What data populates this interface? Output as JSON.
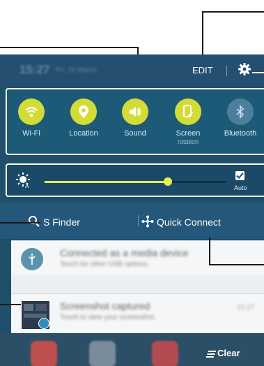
{
  "status_bar": {
    "time": "15:27",
    "date": "Fri, 15 March",
    "edit_label": "EDIT"
  },
  "quick_settings": [
    {
      "label": "Wi-Fi",
      "sublabel": "",
      "color": "#d3dc35",
      "icon": "wifi-icon"
    },
    {
      "label": "Location",
      "sublabel": "",
      "color": "#d3dc35",
      "icon": "location-icon"
    },
    {
      "label": "Sound",
      "sublabel": "",
      "color": "#d3dc35",
      "icon": "sound-icon"
    },
    {
      "label": "Screen",
      "sublabel": "rotation",
      "color": "#d3dc35",
      "icon": "screen-rotation-icon"
    },
    {
      "label": "Bluetooth",
      "sublabel": "",
      "color": "#4a7f9e",
      "icon": "bluetooth-icon"
    }
  ],
  "brightness": {
    "level": 0.68,
    "auto_label": "Auto",
    "auto_checked": true
  },
  "finder": {
    "s_finder_label": "S Finder",
    "quick_connect_label": "Quick Connect"
  },
  "notifications": [
    {
      "title": "Connected as a media device",
      "subtitle": "Touch for other USB options.",
      "time": ""
    },
    {
      "title": "Screenshot captured",
      "subtitle": "Touch to view your screenshot.",
      "time": "15:27"
    }
  ],
  "bottom": {
    "clear_label": "Clear"
  },
  "colors": {
    "accent": "#e7ef4c",
    "panel_bg": "#1e4f6b"
  }
}
